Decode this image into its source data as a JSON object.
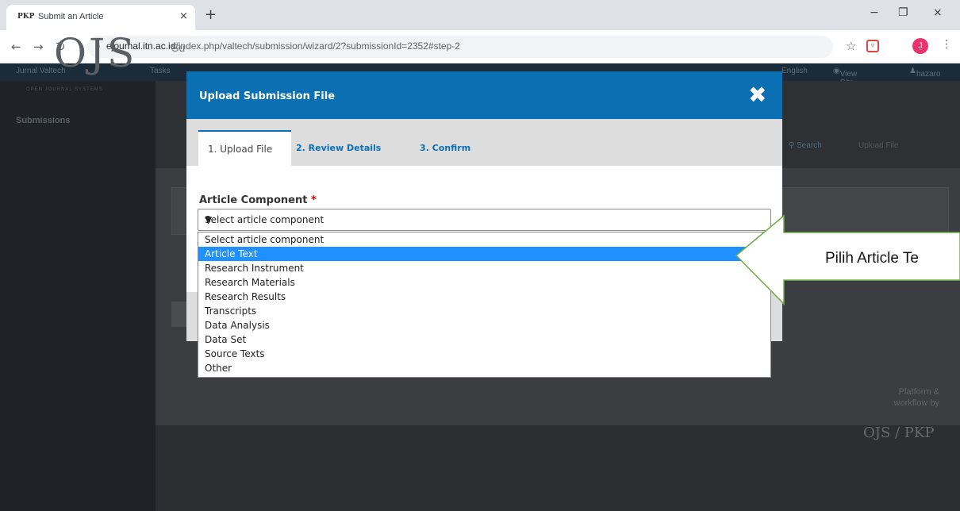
{
  "browser": {
    "tab_favicon": "PKP",
    "tab_title": "Submit an Article",
    "tab_close": "×",
    "new_tab": "+",
    "window_minimize": "−",
    "window_restore": "❐",
    "window_close": "×",
    "url_domain": "ejournal.itn.ac.id",
    "url_path": "/index.php/valtech/submission/wizard/2?submissionId=2352#step-2",
    "profile_initial": "J"
  },
  "page": {
    "site_name": "Jurnal Valtech",
    "tasks_label": "Tasks",
    "language_label": "English",
    "view_site_label": "View Site",
    "user_label": "hazaro",
    "logo_text": "OJS",
    "logo_tagline": "OPEN JOURNAL SYSTEMS",
    "sidebar_submissions": "Submissions",
    "main_heading_fragment": "Su",
    "search_label": "Search",
    "upload_file_label": "Upload File",
    "footer_platform": "Platform &",
    "footer_workflow": "workflow by",
    "footer_logo": "OJS / PKP"
  },
  "modal": {
    "title": "Upload Submission File",
    "close_glyph": "✖",
    "tabs": [
      {
        "label": "1. Upload File"
      },
      {
        "label": "2. Review Details"
      },
      {
        "label": "3. Confirm"
      }
    ],
    "field_label": "Article Component",
    "required_marker": "*",
    "select_value": "Select article component",
    "options": [
      "Select article component",
      "Article Text",
      "Research Instrument",
      "Research Materials",
      "Research Results",
      "Transcripts",
      "Data Analysis",
      "Data Set",
      "Source Texts",
      "Other"
    ],
    "highlighted_option": "Article Text"
  },
  "annotation": {
    "text": "Pilih Article Te"
  },
  "colors": {
    "header_blue": "#0a6fb3",
    "option_highlight": "#1e90ff",
    "callout_stroke": "#70ad47"
  }
}
